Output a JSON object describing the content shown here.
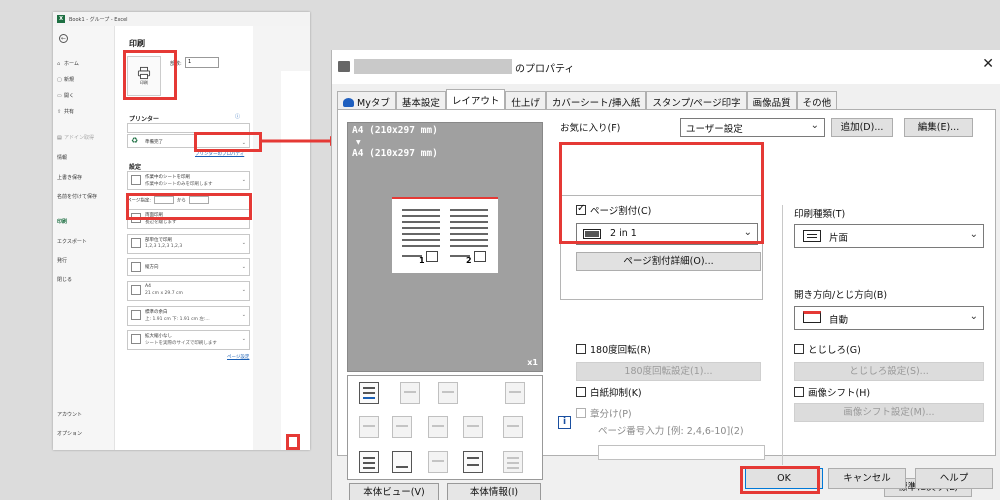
{
  "excel": {
    "window_title": "Book1 - グループ - Excel",
    "nav_items": [
      {
        "icon": "home-icon",
        "glyph": "⌂",
        "label": "ホーム"
      },
      {
        "icon": "new-file-icon",
        "glyph": "▢",
        "label": "新規"
      },
      {
        "icon": "open-folder-icon",
        "glyph": "▭",
        "label": "開く"
      },
      {
        "icon": "share-icon",
        "glyph": "⇪",
        "label": "共有"
      },
      {
        "icon": "adobe-pdf-icon",
        "glyph": "▤",
        "label": "アドイン取得"
      },
      {
        "icon": "",
        "glyph": "",
        "label": "情報"
      },
      {
        "icon": "",
        "glyph": "",
        "label": "上書き保存"
      },
      {
        "icon": "",
        "glyph": "",
        "label": "名前を付けて保存"
      },
      {
        "icon": "",
        "glyph": "",
        "label": "印刷"
      },
      {
        "icon": "",
        "glyph": "",
        "label": "エクスポート"
      },
      {
        "icon": "",
        "glyph": "",
        "label": "発行"
      },
      {
        "icon": "",
        "glyph": "",
        "label": "閉じる"
      }
    ],
    "nav_bottom": [
      "アカウント",
      "オプション"
    ],
    "print_title": "印刷",
    "print_button_label": "印刷",
    "copies_label": "部数:",
    "copies_value": "1",
    "printer_section": "プリンター",
    "printer_status": "準備完了",
    "printer_props_link": "プリンターのプロパティ",
    "settings_section": "設定",
    "settings": [
      {
        "t1": "作業中のシートを印刷",
        "t2": "作業中のシートのみを印刷します"
      },
      {
        "t1": "両面印刷",
        "t2": "長辺を綴じます"
      },
      {
        "t1": "部単位で印刷",
        "t2": "1,2,3    1,2,3    1,2,3"
      },
      {
        "t1": "縦方向",
        "t2": ""
      },
      {
        "t1": "A4",
        "t2": "21 cm x 29.7 cm"
      },
      {
        "t1": "標準の余白",
        "t2": "上: 1.91 cm 下: 1.91 cm 左:..."
      },
      {
        "t1": "拡大縮小なし",
        "t2": "シートを実際のサイズで印刷します"
      }
    ],
    "page_range_label": "ページ指定:",
    "page_range_to": "から",
    "page_setup_link": "ページ設定"
  },
  "dialog": {
    "title_suffix": "のプロパティ",
    "close_glyph": "✕",
    "tabs": [
      "Myタブ",
      "基本設定",
      "レイアウト",
      "仕上げ",
      "カバーシート/挿入紙",
      "スタンプ/ページ印字",
      "画像品質",
      "その他"
    ],
    "active_tab": "レイアウト",
    "preview": {
      "line1": "A4 (210x297 mm)",
      "arrow": "▼",
      "line2": "A4 (210x297 mm)",
      "count": "x1",
      "num1": "1",
      "num2": "2"
    },
    "preview_buttons": [
      "本体ビュー(V)",
      "本体情報(I)"
    ],
    "favorites_label": "お気に入り(F)",
    "favorites_value": "ユーザー設定",
    "add_button": "追加(D)...",
    "edit_button": "編集(E)...",
    "combine_label": "ページ割付(C)",
    "combine_checked": true,
    "combine_value": "2 in 1",
    "combine_detail_button": "ページ割付詳細(O)...",
    "rotate_label": "180度回転(R)",
    "rotate_button": "180度回転設定(1)...",
    "blank_label": "白紙抑制(K)",
    "chapter_label": "章分け(P)",
    "page_number_input_label": "ページ番号入力 [例: 2,4,6-10](2)",
    "print_type_label": "印刷種類(T)",
    "print_type_value": "片面",
    "binding_label": "開き方向/とじ方向(B)",
    "binding_value": "自動",
    "margin_label": "とじしろ(G)",
    "margin_button": "とじしろ設定(S)...",
    "shift_label": "画像シフト(H)",
    "shift_button": "画像シフト設定(M)...",
    "reset_button": "標準に戻す(L)",
    "ok_button": "OK",
    "cancel_button": "キャンセル",
    "help_button": "ヘルプ"
  },
  "colors": {
    "highlight": "#e53935",
    "excel_green": "#1d6f42",
    "link_blue": "#1a5fb4"
  }
}
